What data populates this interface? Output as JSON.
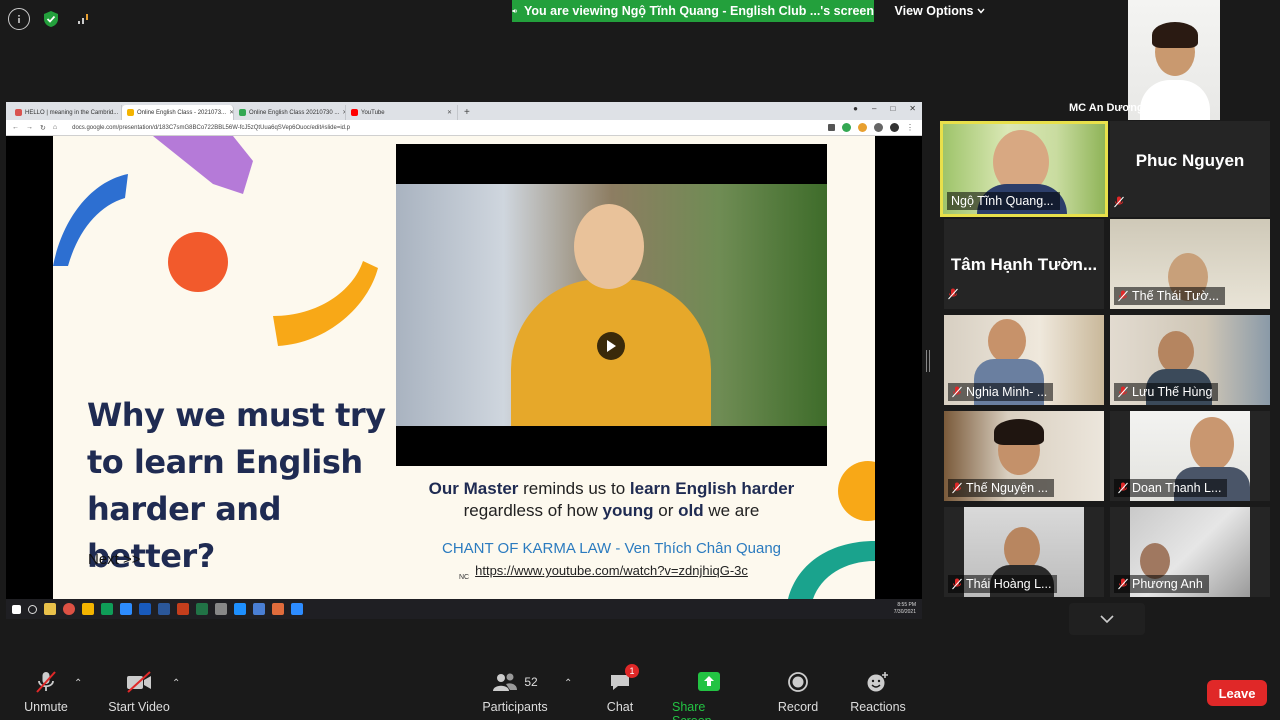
{
  "banner": {
    "text": "You are viewing Ngộ Tĩnh Quang - English Club ...'s screen"
  },
  "view_options": {
    "label": "View Options"
  },
  "browser": {
    "tabs": [
      {
        "label": "HELLO | meaning in the Cambrid..."
      },
      {
        "label": "Online English Class - 2021073..."
      },
      {
        "label": "Online English Class 20210730 ..."
      },
      {
        "label": "YouTube"
      }
    ],
    "url": "docs.google.com/presentation/d/183C7smG8BCo722BBL56W-fcJ5zQtUua6qSVep6Ouoc/edit#slide=id.p"
  },
  "slide": {
    "title": "Why we must try to learn English harder and better?",
    "next": "Next >>",
    "caption_line1_a": "Our Master",
    "caption_line1_b": " reminds us to ",
    "caption_line1_c": "learn English harder",
    "caption_line2_a": "regardless of how ",
    "caption_line2_b": "young",
    "caption_line2_c": " or ",
    "caption_line2_d": "old",
    "caption_line2_e": " we are",
    "chant": "CHANT OF KARMA LAW - Ven Thích Chân Quang",
    "link": "https://www.youtube.com/watch?v=zdnjhiqG-3c",
    "nc": "NC"
  },
  "taskbar": {
    "time": "8:55 PM",
    "date": "7/30/2021"
  },
  "mc": {
    "name": "MC An Dương"
  },
  "participants_tiles": [
    {
      "name": "Ngộ Tĩnh Quang...",
      "type": "video"
    },
    {
      "name": "Phuc Nguyen",
      "type": "name"
    },
    {
      "name": "Tâm Hạnh Tườn...",
      "type": "name"
    },
    {
      "name": "Thế Thái Tườ...",
      "type": "video"
    },
    {
      "name": "Nghia Minh- ...",
      "type": "video"
    },
    {
      "name": "Lưu Thế Hùng",
      "type": "video"
    },
    {
      "name": "Thế Nguyện ...",
      "type": "video"
    },
    {
      "name": "Doan Thanh L...",
      "type": "video"
    },
    {
      "name": "Thái Hoàng L...",
      "type": "video"
    },
    {
      "name": "Phương Anh",
      "type": "video"
    }
  ],
  "toolbar": {
    "unmute": "Unmute",
    "start_video": "Start Video",
    "participants": "Participants",
    "participants_count": "52",
    "chat": "Chat",
    "chat_badge": "1",
    "share_screen": "Share Screen",
    "record": "Record",
    "reactions": "Reactions",
    "leave": "Leave"
  },
  "colors": {
    "banner_green": "#23a03c",
    "leave_red": "#e02828",
    "active_speaker": "#e8e04b",
    "share_green": "#23c343"
  }
}
